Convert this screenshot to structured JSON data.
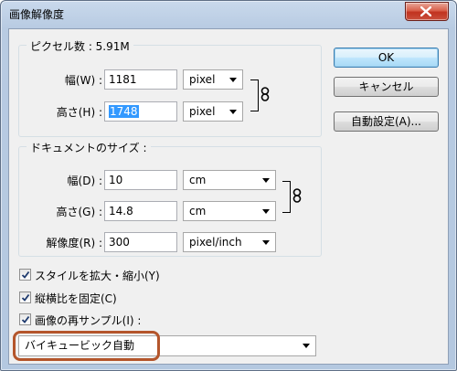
{
  "window": {
    "title": "画像解像度"
  },
  "buttons": {
    "ok": "OK",
    "cancel": "キャンセル",
    "auto": "自動設定(A)..."
  },
  "pixel_dimensions": {
    "legend": "ピクセル数 : 5.91M",
    "width": {
      "label": "幅(W) :",
      "value": "1181",
      "unit": "pixel"
    },
    "height": {
      "label": "高さ(H) :",
      "value": "1748",
      "unit": "pixel"
    }
  },
  "document_size": {
    "legend": "ドキュメントのサイズ :",
    "width": {
      "label": "幅(D) :",
      "value": "10",
      "unit": "cm"
    },
    "height": {
      "label": "高さ(G) :",
      "value": "14.8",
      "unit": "cm"
    },
    "resolution": {
      "label": "解像度(R) :",
      "value": "300",
      "unit": "pixel/inch"
    }
  },
  "options": {
    "scale_styles": {
      "label": "スタイルを拡大・縮小(Y)",
      "checked": true
    },
    "constrain": {
      "label": "縦横比を固定(C)",
      "checked": true
    },
    "resample": {
      "label": "画像の再サンプル(I) :",
      "checked": true
    }
  },
  "resample_method": "バイキュービック自動"
}
